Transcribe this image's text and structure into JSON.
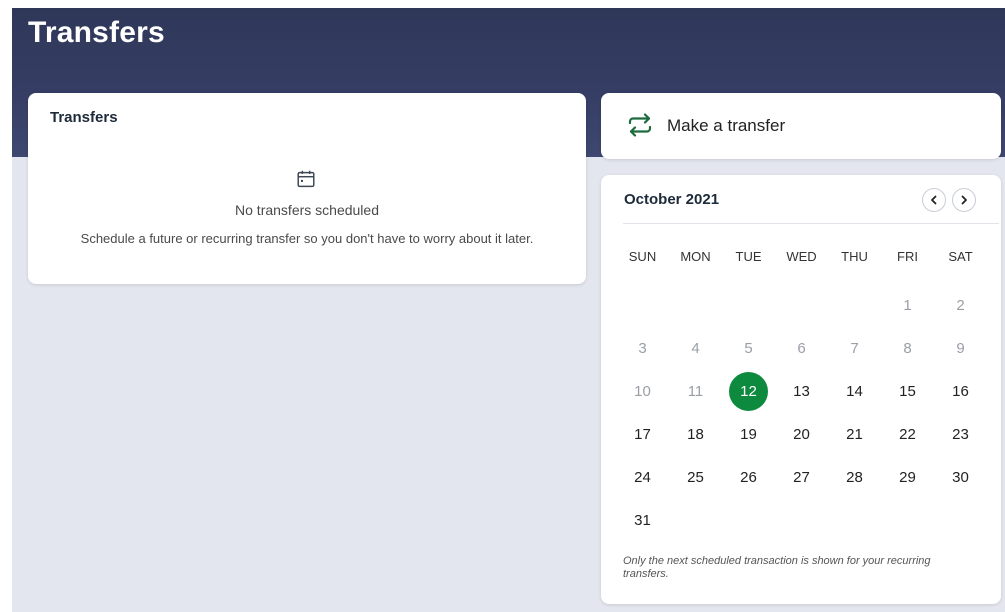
{
  "header": {
    "title": "Transfers"
  },
  "transfers_card": {
    "title": "Transfers",
    "icon": "calendar-icon",
    "empty_title": "No transfers scheduled",
    "empty_desc": "Schedule a future or recurring transfer so you don't have to worry about it later."
  },
  "make_transfer": {
    "icon": "transfer-arrows-icon",
    "label": "Make a transfer"
  },
  "calendar": {
    "month": "October 2021",
    "prev_icon": "chevron-left-icon",
    "next_icon": "chevron-right-icon",
    "weekdays": [
      "SUN",
      "MON",
      "TUE",
      "WED",
      "THU",
      "FRI",
      "SAT"
    ],
    "days": [
      {
        "label": "",
        "state": "empty"
      },
      {
        "label": "",
        "state": "empty"
      },
      {
        "label": "",
        "state": "empty"
      },
      {
        "label": "",
        "state": "empty"
      },
      {
        "label": "",
        "state": "empty"
      },
      {
        "label": "1",
        "state": "muted"
      },
      {
        "label": "2",
        "state": "muted"
      },
      {
        "label": "3",
        "state": "muted"
      },
      {
        "label": "4",
        "state": "muted"
      },
      {
        "label": "5",
        "state": "muted"
      },
      {
        "label": "6",
        "state": "muted"
      },
      {
        "label": "7",
        "state": "muted"
      },
      {
        "label": "8",
        "state": "muted"
      },
      {
        "label": "9",
        "state": "muted"
      },
      {
        "label": "10",
        "state": "muted"
      },
      {
        "label": "11",
        "state": "muted"
      },
      {
        "label": "12",
        "state": "selected"
      },
      {
        "label": "13",
        "state": "active"
      },
      {
        "label": "14",
        "state": "active"
      },
      {
        "label": "15",
        "state": "active"
      },
      {
        "label": "16",
        "state": "active"
      },
      {
        "label": "17",
        "state": "active"
      },
      {
        "label": "18",
        "state": "active"
      },
      {
        "label": "19",
        "state": "active"
      },
      {
        "label": "20",
        "state": "active"
      },
      {
        "label": "21",
        "state": "active"
      },
      {
        "label": "22",
        "state": "active"
      },
      {
        "label": "23",
        "state": "active"
      },
      {
        "label": "24",
        "state": "active"
      },
      {
        "label": "25",
        "state": "active"
      },
      {
        "label": "26",
        "state": "active"
      },
      {
        "label": "27",
        "state": "active"
      },
      {
        "label": "28",
        "state": "active"
      },
      {
        "label": "29",
        "state": "active"
      },
      {
        "label": "30",
        "state": "active"
      },
      {
        "label": "31",
        "state": "active"
      }
    ],
    "note": "Only the next scheduled transaction is shown for your recurring transfers."
  },
  "colors": {
    "banner": "#353d64",
    "background": "#e3e6ee",
    "accent": "#0e8a3f",
    "icon_green": "#1c6b3c"
  }
}
